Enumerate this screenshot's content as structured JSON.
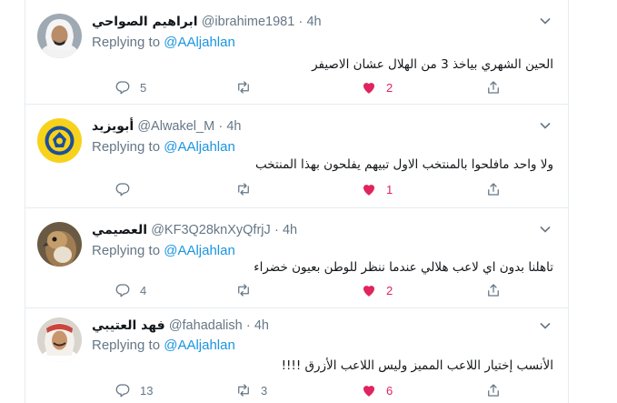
{
  "tweets": [
    {
      "name": "ابراهيم الصواحي",
      "handle": "@ibrahime1981",
      "time": "4h",
      "replying_prefix": "Replying to",
      "replying_to": "@AAljahlan",
      "text": "الحين الشهري بياخذ 3 من الهلال عشان الاصيفر",
      "replies": "5",
      "retweets": "",
      "likes": "2",
      "liked": true
    },
    {
      "name": "أبويزيد",
      "handle": "@Alwakel_M",
      "time": "4h",
      "replying_prefix": "Replying to",
      "replying_to": "@AAljahlan",
      "text": "ولا واحد مافلحوا بالمنتخب الاول تبيهم يفلحون بهذا المنتخب",
      "replies": "",
      "retweets": "",
      "likes": "1",
      "liked": true
    },
    {
      "name": "العصيمي",
      "handle": "@KF3Q28knXyQfrjJ",
      "time": "4h",
      "replying_prefix": "Replying to",
      "replying_to": "@AAljahlan",
      "text": "تاهلنا بدون اي لاعب هلالي عندما ننظر للوطن بعيون خضراء",
      "replies": "4",
      "retweets": "",
      "likes": "2",
      "liked": true
    },
    {
      "name": "فهد العتيبي",
      "handle": "@fahadalish",
      "time": "4h",
      "replying_prefix": "Replying to",
      "replying_to": "@AAljahlan",
      "text": "الأنسب إختيار اللاعب المميز وليس اللاعب الأزرق !!!!",
      "replies": "13",
      "retweets": "3",
      "likes": "6",
      "liked": true
    }
  ],
  "colors": {
    "accent": "#1b95e0",
    "like": "#e0245e",
    "muted": "#657786",
    "border": "#e6ecf0"
  },
  "icons": [
    "chevron-down-icon",
    "reply-icon",
    "retweet-icon",
    "heart-icon",
    "share-icon"
  ]
}
